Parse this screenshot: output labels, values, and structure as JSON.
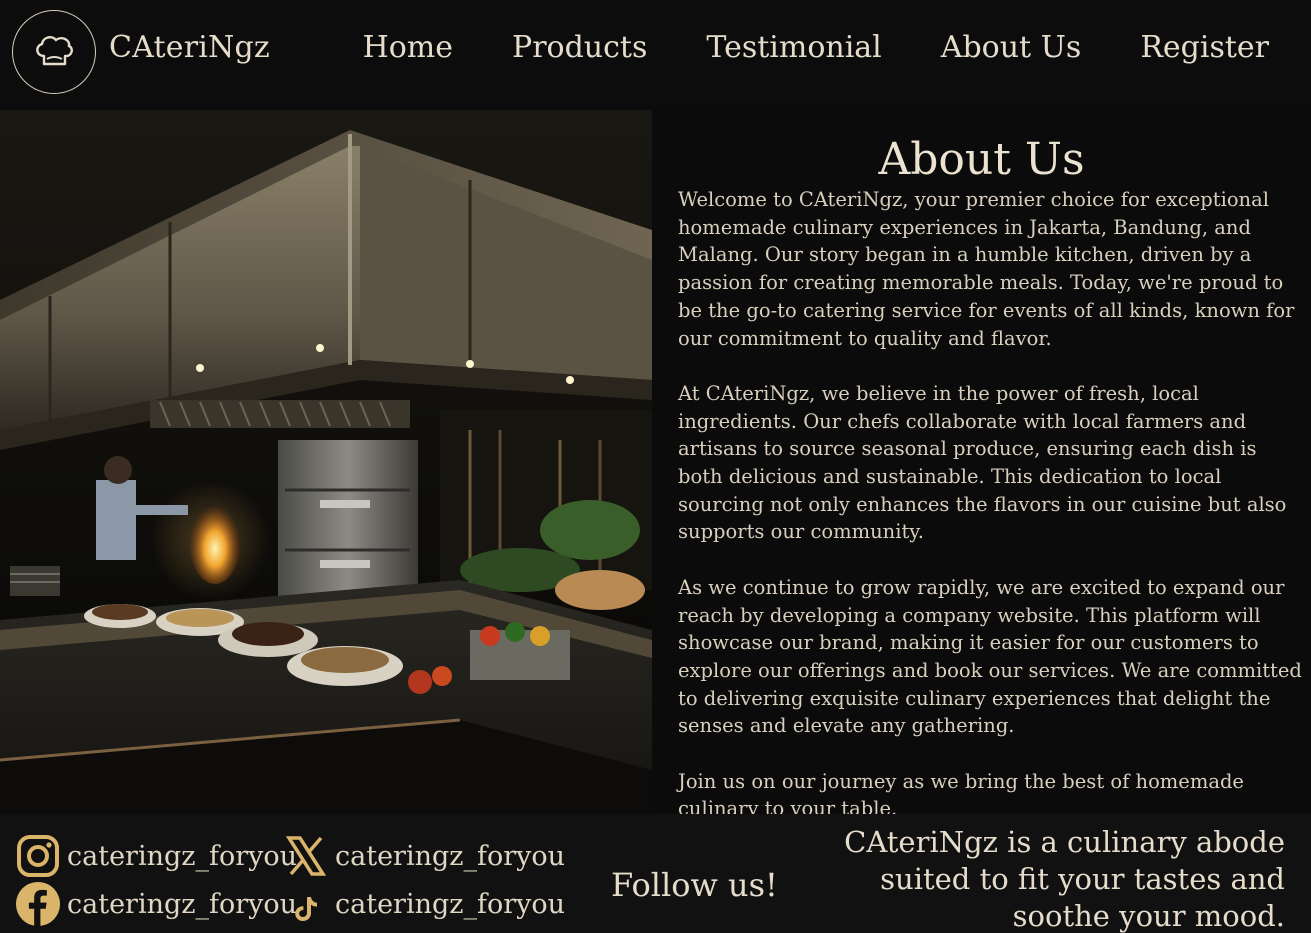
{
  "brand": {
    "name": "CAteriNgz",
    "logo_icon": "chef-hat-icon"
  },
  "nav": [
    {
      "label": "Home"
    },
    {
      "label": "Products"
    },
    {
      "label": "Testimonial"
    },
    {
      "label": "About Us"
    },
    {
      "label": "Register"
    }
  ],
  "about": {
    "title": "About Us",
    "paragraphs": [
      "Welcome to CAteriNgz, your premier choice for exceptional homemade culinary experiences in Jakarta, Bandung, and Malang. Our story began in a humble kitchen, driven by a passion for creating memorable meals. Today, we're proud to be the go-to catering service for events of all kinds, known for our commitment to quality and flavor.",
      "At CAteriNgz, we believe in the power of fresh, local ingredients. Our chefs collaborate with local farmers and artisans to source seasonal produce, ensuring each dish is both delicious and sustainable. This dedication to local sourcing not only enhances the flavors in our cuisine but also supports our community.",
      "As we continue to grow rapidly, we are excited to expand our reach by developing a company website. This platform will showcase our brand, making it easier for our customers to explore our offerings and book our services. We are committed to delivering exquisite culinary experiences that delight the senses and elevate any gathering.",
      "Join us on our journey as we bring the best of homemade culinary to your table."
    ]
  },
  "footer": {
    "socials": [
      {
        "icon": "instagram-icon",
        "handle": "cateringz_foryou"
      },
      {
        "icon": "x-icon",
        "handle": "cateringz_foryou"
      },
      {
        "icon": "facebook-icon",
        "handle": "cateringz_foryou"
      },
      {
        "icon": "tiktok-icon",
        "handle": "cateringz_foryou"
      }
    ],
    "follow_label": "Follow us!",
    "tagline": "CAteriNgz is a culinary abode suited to fit your tastes and soothe your mood."
  },
  "colors": {
    "background": "#0b0b0b",
    "text": "#e6dccb",
    "accent_gold": "#d9b46a"
  }
}
